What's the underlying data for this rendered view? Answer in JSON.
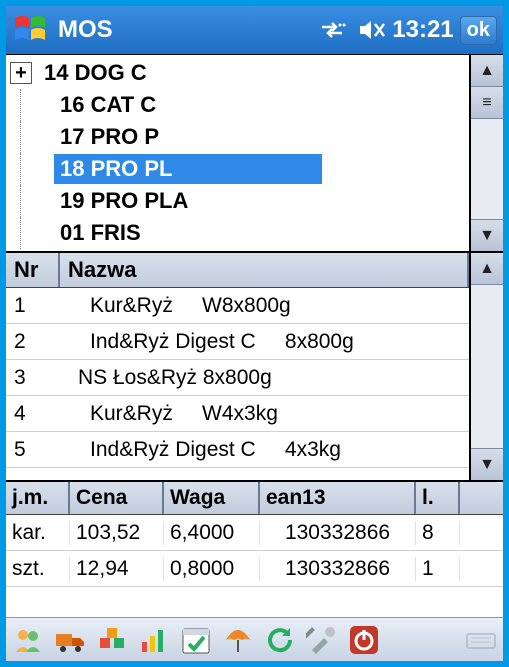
{
  "titlebar": {
    "app_title": "MOS",
    "clock": "13:21",
    "ok_label": "ok"
  },
  "tree": {
    "items": [
      {
        "label": "14 DOG C",
        "expandable": true,
        "selected": false
      },
      {
        "label": "16 CAT C",
        "expandable": false,
        "selected": false
      },
      {
        "label": "17 PRO P",
        "expandable": false,
        "selected": false
      },
      {
        "label": "18 PRO PL",
        "expandable": false,
        "selected": true
      },
      {
        "label": "19 PRO PLA",
        "expandable": false,
        "selected": false
      },
      {
        "label": "01 FRIS",
        "expandable": false,
        "selected": false
      }
    ]
  },
  "products": {
    "columns": {
      "nr": "Nr",
      "nazwa": "Nazwa"
    },
    "rows": [
      {
        "nr": "1",
        "nazwa": "Kur&Ryż     W8x800g"
      },
      {
        "nr": "2",
        "nazwa": "Ind&Ryż Digest C     8x800g"
      },
      {
        "nr": "3",
        "nazwa": "NS Łos&Ryż 8x800g"
      },
      {
        "nr": "4",
        "nazwa": "Kur&Ryż     W4x3kg"
      },
      {
        "nr": "5",
        "nazwa": "Ind&Ryż Digest C     4x3kg"
      }
    ]
  },
  "units": {
    "columns": {
      "jm": "j.m.",
      "cena": "Cena",
      "waga": "Waga",
      "ean": "ean13",
      "l": "l."
    },
    "rows": [
      {
        "jm": "kar.",
        "cena": "103,52",
        "waga": "6,4000",
        "ean": "130332866",
        "l": "8"
      },
      {
        "jm": "szt.",
        "cena": "12,94",
        "waga": "0,8000",
        "ean": "130332866",
        "l": "1"
      }
    ]
  },
  "toolbar_icons": [
    "users-icon",
    "truck-icon",
    "boxes-icon",
    "chart-icon",
    "calendar-check-icon",
    "umbrella-icon",
    "refresh-icon",
    "tools-icon",
    "power-icon",
    "keyboard-icon"
  ]
}
